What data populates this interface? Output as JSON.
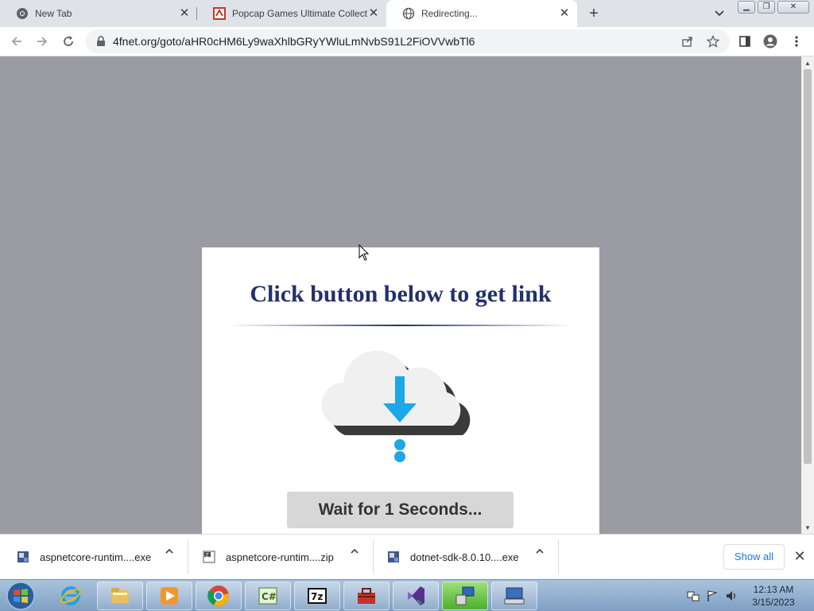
{
  "tabs": [
    {
      "title": "New Tab"
    },
    {
      "title": "Popcap Games Ultimate Collection"
    },
    {
      "title": "Redirecting..."
    }
  ],
  "toolbar": {
    "url": "4fnet.org/goto/aHR0cHM6Ly9waXhlbGRyYWluLmNvbS91L2FiOVVwbTl6"
  },
  "page": {
    "heading": "Click button below to get link",
    "wait_button": "Wait for 1 Seconds...",
    "accent_color": "#1ba7e8",
    "heading_color": "#23306b"
  },
  "downloads": {
    "items": [
      {
        "name": "aspnetcore-runtim....exe"
      },
      {
        "name": "aspnetcore-runtim....zip"
      },
      {
        "name": "dotnet-sdk-8.0.10....exe"
      }
    ],
    "show_all": "Show all"
  },
  "taskbar": {
    "apps": [
      "internet-explorer-icon",
      "file-explorer-icon",
      "media-player-icon",
      "chrome-icon",
      "csharp-icon",
      "7zip-icon",
      "toolbox-icon",
      "visual-studio-icon",
      "network-icon",
      "keyboard-icon"
    ],
    "time": "12:13 AM",
    "date": "3/15/2023"
  }
}
